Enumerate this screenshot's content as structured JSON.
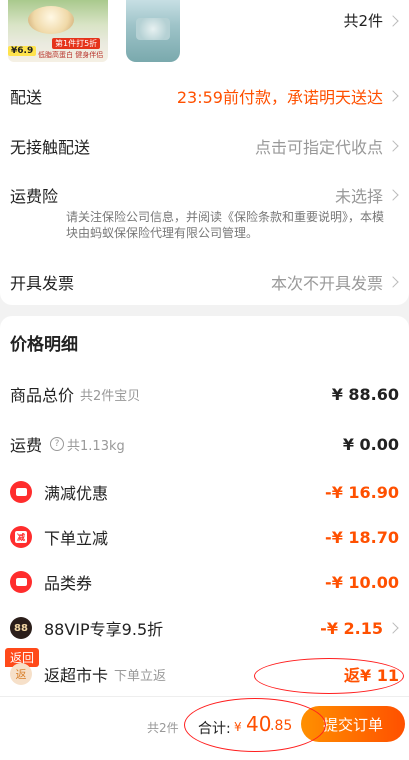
{
  "product_strip": {
    "thumb1": {
      "price": "¥6.9",
      "tag": "第1件打5折",
      "slogan": "低脂高蛋白 健身伴侣"
    },
    "count_text": "共2件"
  },
  "order_rows": {
    "delivery": {
      "label": "配送",
      "value": "23:59前付款，承诺明天送达"
    },
    "contactless": {
      "label": "无接触配送",
      "value": "点击可指定代收点"
    },
    "shipping_insurance": {
      "label": "运费险",
      "value": "未选择",
      "note": "请关注保险公司信息，并阅读《保险条款和重要说明》，本模块由蚂蚁保保险代理有限公司管理。"
    },
    "invoice": {
      "label": "开具发票",
      "value": "本次不开具发票"
    }
  },
  "price_detail": {
    "title": "价格明细",
    "items_total": {
      "label": "商品总价",
      "sub": "共2件宝贝",
      "amount": "¥ 88.60"
    },
    "freight": {
      "label": "运费",
      "q": "?",
      "sub": "共1.13kg",
      "amount": "¥ 0.00"
    },
    "full_reduction": {
      "label": "满减优惠",
      "amount": "-¥ 16.90"
    },
    "order_discount": {
      "label": "下单立减",
      "icon_text": "减",
      "amount": "-¥ 18.70"
    },
    "category_coupon": {
      "label": "品类券",
      "amount": "-¥ 10.00"
    },
    "vip": {
      "label": "88VIP专享9.5折",
      "icon_text": "88",
      "amount": "-¥ 2.15"
    },
    "supermarket_card": {
      "badge": "返回",
      "label": "返超市卡",
      "icon_text": "返",
      "sub": "下单立返",
      "amount": "返¥ 11"
    }
  },
  "footer": {
    "count": "共2件",
    "total_label": "合计:",
    "currency": "¥",
    "total_int": "40",
    "total_dec": ".85",
    "submit_label": "提交订单"
  },
  "colors": {
    "accent": "#ff5000",
    "annotation": "#ff1f1f"
  }
}
